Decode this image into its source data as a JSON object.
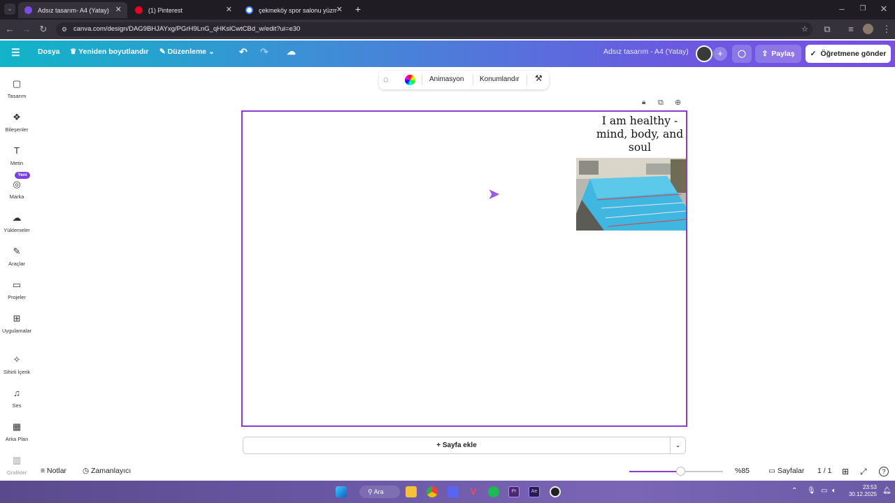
{
  "browser": {
    "tabs": [
      {
        "title": "Adsız tasarım- A4 (Yatay)",
        "active": true,
        "favicon_color": "#7a4ee4"
      },
      {
        "title": "(1) Pinterest",
        "active": false,
        "favicon_color": "#e60023"
      },
      {
        "title": "çekmeköy spor salonu yüzme",
        "active": false,
        "favicon_color": "#ffffff"
      }
    ],
    "url": "canva.com/design/DAG9BHJAYxg/PGrH9LnG_qHKslCwtCBd_w/edit?ui=e30"
  },
  "appbar": {
    "file": "Dosya",
    "resize": "Yeniden boyutlandır",
    "edit": "Düzenleme",
    "doc_title": "Adsız tasarım - A4 (Yatay)",
    "share": "Paylaş",
    "send_teacher": "Öğretmene gönder"
  },
  "sidebar": {
    "items": [
      {
        "label": "Tasarım",
        "icon": "layout-icon",
        "glyph": "▢"
      },
      {
        "label": "Bileşenler",
        "icon": "elements-icon",
        "glyph": "❖"
      },
      {
        "label": "Metin",
        "icon": "text-icon",
        "glyph": "T"
      },
      {
        "label": "Marka",
        "icon": "brand-icon",
        "glyph": "◎",
        "badge": "Yeni"
      },
      {
        "label": "Yüklemeler",
        "icon": "cloud-upload-icon",
        "glyph": "☁"
      },
      {
        "label": "Araçlar",
        "icon": "draw-icon",
        "glyph": "✎"
      },
      {
        "label": "Projeler",
        "icon": "folder-icon",
        "glyph": "▭"
      },
      {
        "label": "Uygulamalar",
        "icon": "apps-icon",
        "glyph": "⊞"
      },
      {
        "label": "Sihirli İçerik",
        "icon": "magic-media-icon",
        "glyph": "✧"
      },
      {
        "label": "Ses",
        "icon": "music-icon",
        "glyph": "♫"
      },
      {
        "label": "Arka Plan",
        "icon": "background-icon",
        "glyph": "▦"
      },
      {
        "label": "Grafikler",
        "icon": "charts-icon",
        "glyph": "▥"
      }
    ]
  },
  "toolbar": {
    "animate": "Animasyon",
    "position": "Konumlandır"
  },
  "canvas": {
    "headline": "I am healthy - mind, body, and soul"
  },
  "bottom": {
    "add_page": "+ Sayfa ekle",
    "notes": "Notlar",
    "timer": "Zamanlayıcı",
    "zoom": "%85",
    "zoom_level": 0.55,
    "pages": "Sayfalar",
    "page_count": "1 / 1"
  },
  "taskbar": {
    "search": "Ara",
    "time": "23:53",
    "date": "30.12.2025"
  }
}
